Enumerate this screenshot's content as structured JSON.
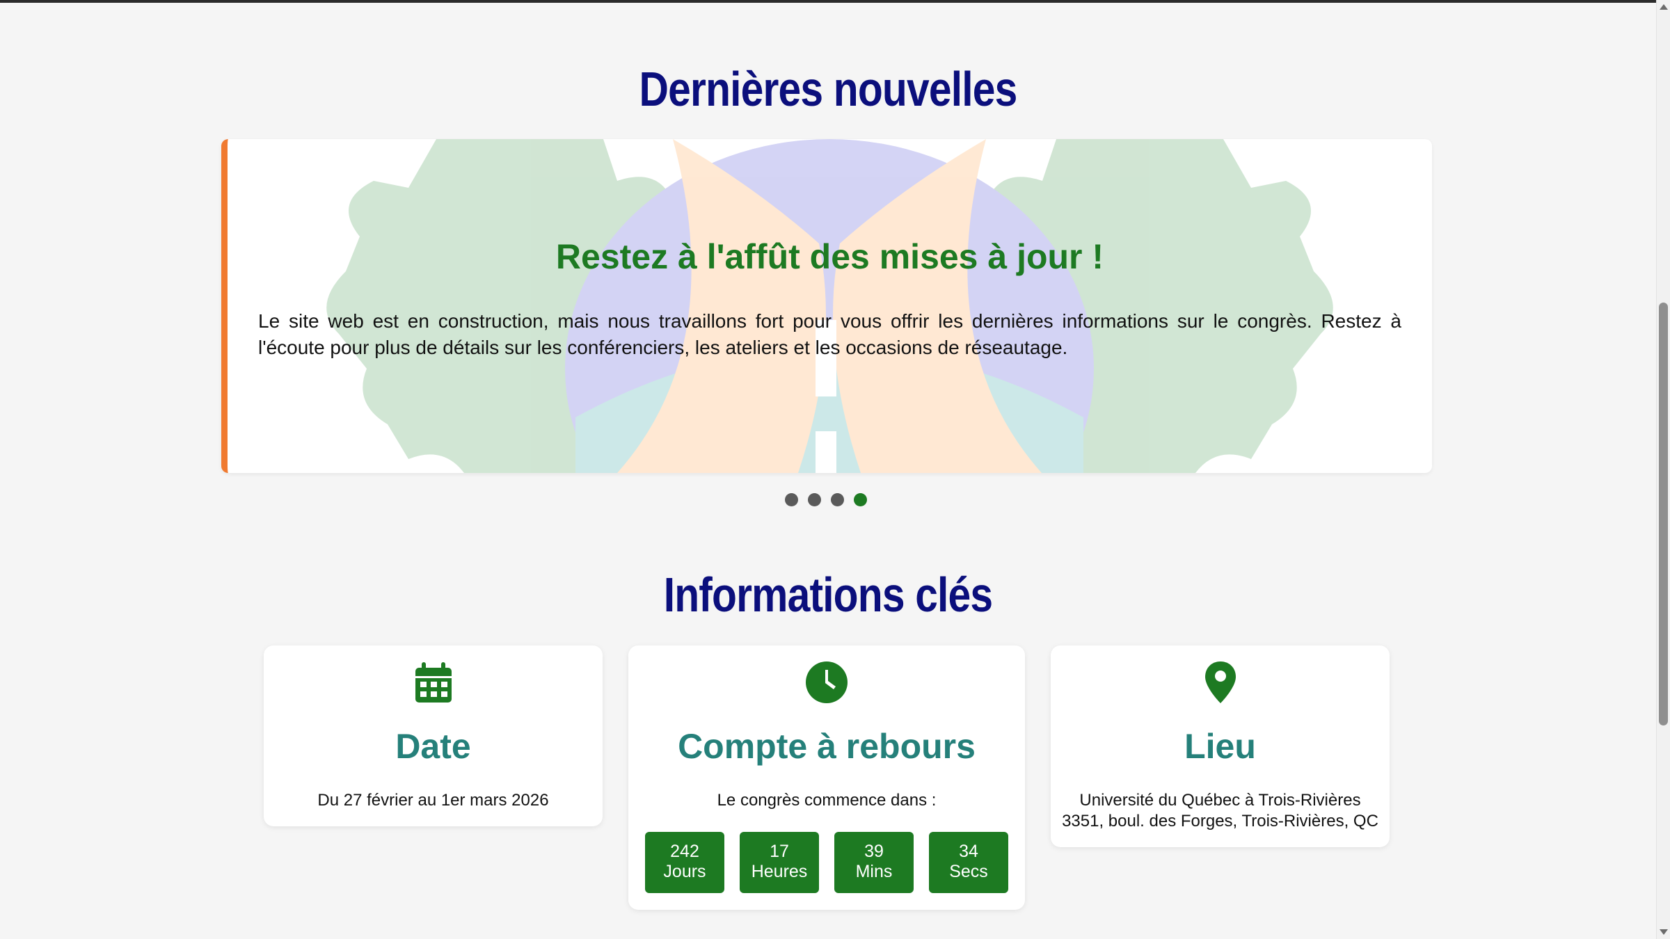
{
  "news": {
    "title": "Dernières nouvelles",
    "slide": {
      "title": "Restez à l'affût des mises à jour !",
      "text": "Le site web est en construction, mais nous travaillons fort pour vous offrir les dernières informations sur le congrès. Restez à l'écoute pour plus de détails sur les conférenciers, les ateliers et les occasions de réseautage."
    },
    "dots": {
      "count": 4,
      "active_index": 3
    }
  },
  "info": {
    "title": "Informations clés",
    "date": {
      "icon": "calendar-icon",
      "heading": "Date",
      "text": "Du 27 février au 1er mars 2026"
    },
    "countdown": {
      "icon": "clock-icon",
      "heading": "Compte à rebours",
      "intro": "Le congrès commence dans :",
      "units": [
        {
          "value": "242",
          "label": "Jours"
        },
        {
          "value": "17",
          "label": "Heures"
        },
        {
          "value": "39",
          "label": "Mins"
        },
        {
          "value": "34",
          "label": "Secs"
        }
      ]
    },
    "place": {
      "icon": "location-pin-icon",
      "heading": "Lieu",
      "line1": "Université du Québec à Trois-Rivières",
      "line2": "3351, boul. des Forges, Trois-Rivières, QC"
    }
  },
  "colors": {
    "title_blue": "#0b0f7c",
    "accent_green": "#1d7a22",
    "teal": "#25807a",
    "accent_orange": "#f07a30"
  }
}
